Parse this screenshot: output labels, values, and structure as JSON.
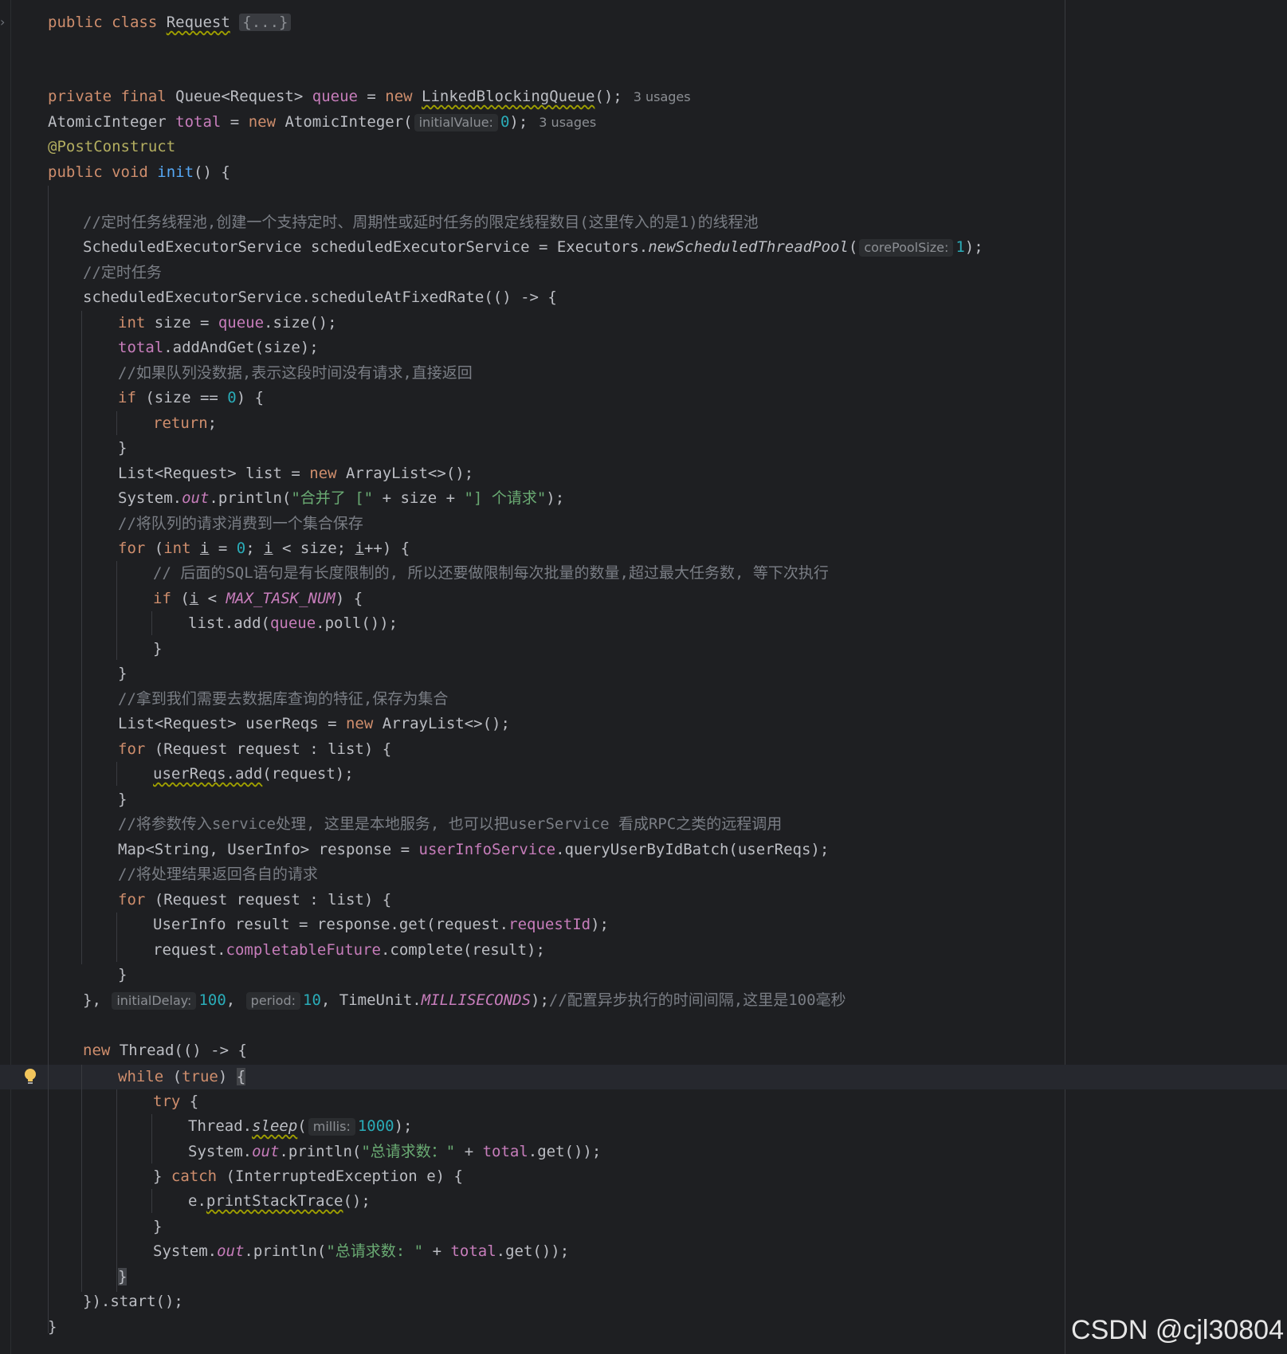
{
  "editor": {
    "class_decl": {
      "kw": "public class ",
      "name": "Request",
      "fold": "{...}"
    },
    "queue_decl": {
      "kw1": "private final ",
      "type": "Queue<Request> ",
      "field": "queue",
      "eq": " = ",
      "kw_new": "new ",
      "ctor": "LinkedBlockingQueue",
      "tail": "();",
      "usages": "3 usages"
    },
    "total_decl": {
      "type": "AtomicInteger ",
      "field": "total",
      "eq": " = ",
      "kw_new": "new ",
      "ctor": "AtomicInteger(",
      "hint": "initialValue:",
      "num": "0",
      "tail": ");",
      "usages": "3 usages"
    },
    "annotation": "@PostConstruct",
    "init_decl": {
      "kw": "public void ",
      "fn": "init",
      "tail": "() {"
    },
    "comment_pool": "//定时任务线程池,创建一个支持定时、周期性或延时任务的限定线程数目(这里传入的是1)的线程池",
    "pool_decl": {
      "text": "ScheduledExecutorService scheduledExecutorService = Executors.",
      "method": "newScheduledThreadPool",
      "open": "(",
      "hint": "corePoolSize:",
      "num": "1",
      "tail": ");"
    },
    "comment_task": "//定时任务",
    "schedule_open": "scheduledExecutorService.scheduleAtFixedRate(() -> {",
    "size_line": {
      "kw": "int ",
      "mid": "size = ",
      "field": "queue",
      "tail": ".size();"
    },
    "add_line": {
      "field": "total",
      "tail": ".addAndGet(size);"
    },
    "comment_empty": "//如果队列没数据,表示这段时间没有请求,直接返回",
    "if_size": {
      "kw": "if ",
      "open": "(size == ",
      "num": "0",
      "tail": ") {"
    },
    "return_kw": "return",
    "return_tail": ";",
    "close_brace": "}",
    "list_decl": {
      "pre": "List<Request> list = ",
      "kw": "new ",
      "tail": "ArrayList<>();"
    },
    "print_merge": {
      "pre": "System.",
      "out": "out",
      "mid": ".println(",
      "s1": "\"合并了 [\"",
      "plus1": " + size + ",
      "s2": "\"] 个请求\"",
      "tail": ");"
    },
    "comment_consume": "//将队列的请求消费到一个集合保存",
    "for_i": {
      "kw": "for ",
      "p1": "(",
      "kw_int": "int ",
      "i": "i",
      "p2": " = ",
      "num": "0",
      "p3": "; ",
      "p4": " < size; ",
      "p5": "++) {"
    },
    "comment_sql": "// 后面的SQL语句是有长度限制的, 所以还要做限制每次批量的数量,超过最大任务数, 等下次执行",
    "if_max": {
      "kw": "if ",
      "p1": "(",
      "i": "i",
      "p2": " < ",
      "const": "MAX_TASK_NUM",
      "tail": ") {"
    },
    "list_add": {
      "pre": "list.add(",
      "field": "queue",
      "tail": ".poll());"
    },
    "comment_features": "//拿到我们需要去数据库查询的特征,保存为集合",
    "userreqs_decl": {
      "pre": "List<Request> userReqs = ",
      "kw": "new ",
      "tail": "ArrayList<>();"
    },
    "for_req": {
      "kw": "for ",
      "tail": "(Request request : list) {"
    },
    "userreqs_add": {
      "call": "userReqs.add",
      "tail": "(request);"
    },
    "comment_service": "//将参数传入service处理, 这里是本地服务, 也可以把userService 看成RPC之类的远程调用",
    "map_line": {
      "pre": "Map<String, UserInfo> response = ",
      "field": "userInfoService",
      "tail": ".queryUserByIdBatch(userReqs);"
    },
    "comment_return": "//将处理结果返回各自的请求",
    "result_line": {
      "pre": "UserInfo result = response.get(request.",
      "field": "requestId",
      "tail": ");"
    },
    "complete_line": {
      "pre": "request.",
      "field": "completableFuture",
      "tail": ".complete(result);"
    },
    "schedule_close": {
      "pre": "}, ",
      "hint1": "initialDelay:",
      "num1": "100",
      "sep1": ", ",
      "hint2": "period:",
      "num2": "10",
      "mid": ", TimeUnit.",
      "const": "MILLISECONDS",
      "tail": ");",
      "comment": "//配置异步执行的时间间隔,这里是100毫秒"
    },
    "thread_open": {
      "kw": "new ",
      "tail": "Thread(() -> {"
    },
    "while_line": {
      "kw": "while ",
      "open": "(",
      "kw_true": "true",
      "close": ") ",
      "brace": "{"
    },
    "try_line": {
      "kw": "try",
      "tail": " {"
    },
    "sleep_line": {
      "pre": "Thread.",
      "method": "sleep",
      "open": "(",
      "hint": "millis:",
      "num": "1000",
      "tail": ");"
    },
    "print_total1": {
      "pre": "System.",
      "out": "out",
      "mid": ".println(",
      "str": "\"总请求数：\"",
      "plus": " + ",
      "field": "total",
      "tail": ".get());"
    },
    "catch_line": {
      "pre": "} ",
      "kw": "catch",
      "tail": " (InterruptedException e) {"
    },
    "stack_line": {
      "pre": "e.",
      "call": "printStackTrace",
      "tail": "();"
    },
    "print_total2": {
      "pre": "System.",
      "out": "out",
      "mid": ".println(",
      "str": "\"总请求数: \"",
      "plus": " + ",
      "field": "total",
      "tail": ".get());"
    },
    "start_line": "}).start();"
  },
  "watermark": "CSDN @cjl30804",
  "colors": {
    "background": "#1e1f22",
    "keyword": "#cf8e6d",
    "field": "#c77dbb",
    "method": "#56a8f5",
    "number": "#2aacb8",
    "string": "#6aab73",
    "comment": "#7a7e85",
    "annotation": "#b3ae60",
    "text": "#bcbec4"
  },
  "icons": {
    "gutter_bulb": "lightbulb-icon",
    "gutter_fold": "chevron-right-icon"
  }
}
